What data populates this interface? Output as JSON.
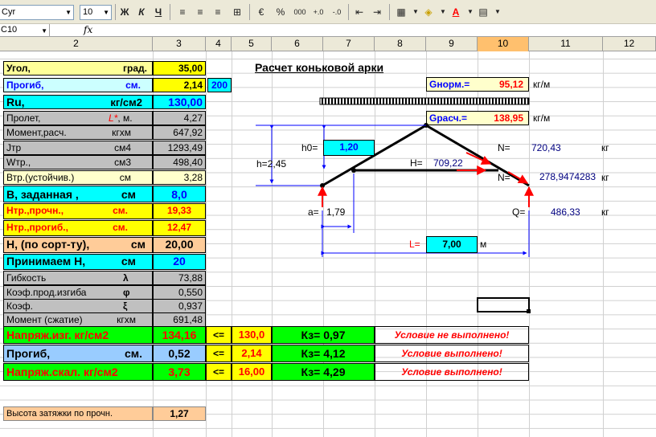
{
  "toolbar": {
    "font_name": "Cyr",
    "font_size": "10",
    "bold": "Ж",
    "italic": "К",
    "underline": "Ч",
    "percent": "%",
    "thousands": "000"
  },
  "formula_bar": {
    "cell_ref": "C10",
    "fx": "fx",
    "formula": ""
  },
  "columns": [
    "2",
    "3",
    "4",
    "5",
    "6",
    "7",
    "8",
    "9",
    "10",
    "11",
    "12"
  ],
  "cells": {
    "angle_label": "Угол,",
    "angle_unit": "град.",
    "angle_val": "35,00",
    "defl_label": "Прогиб,",
    "defl_unit": "см.",
    "defl_val": "2,14",
    "defl_ratio": "200",
    "ru_label": "Ru,",
    "ru_unit": "кг/см2",
    "ru_val": "130,00",
    "span_label": "Пролет,",
    "span_L": "L*",
    "span_unit": ", м.",
    "span_val": "4,27",
    "moment_label": "Момент,расч.",
    "moment_unit": "кгхм",
    "moment_val": "647,92",
    "jtr_label": "Jтр",
    "jtr_unit": "см4",
    "jtr_val": "1293,49",
    "wtr_label": "Wтр.,",
    "wtr_unit": "см3",
    "wtr_val": "498,40",
    "vtr_label": "Втр.(устойчив.)",
    "vtr_unit": "см",
    "vtr_val": "3,28",
    "b_label": "В, заданная ,",
    "b_unit": "см",
    "b_val": "8,0",
    "hp_label": "Нтр.,прочн.,",
    "hp_unit": "см.",
    "hp_val": "19,33",
    "hd_label": "Нтр.,прогиб.,",
    "hd_unit": "см.",
    "hd_val": "12,47",
    "hs_label": "Н, (по сорт-ту),",
    "hs_unit": "см",
    "hs_val": "20,00",
    "ha_label": "Принимаем  Н,",
    "ha_unit": "см",
    "ha_val": "20",
    "flex_label": "Гибкость",
    "flex_sym": "λ",
    "flex_val": "73,88",
    "kbend_label": "Коэф.прод.изгиба",
    "kbend_sym": "φ",
    "kbend_val": "0,550",
    "k_label": "Коэф.",
    "k_sym": "ξ",
    "k_val": "0,937",
    "mc_label": "Момент (сжатие)",
    "mc_unit": "кгхм",
    "mc_val": "691,48",
    "stress_label": "Напряж.изг.   кг/см2",
    "stress_val": "134,16",
    "stress_cmp": "<=",
    "stress_lim": "130,0",
    "stress_kz": "Кз=  0,97",
    "stress_msg": "Условие не выполнено!",
    "def2_label": "Прогиб,",
    "def2_unit": "см.",
    "def2_val": "0,52",
    "def2_cmp": "<=",
    "def2_lim": "2,14",
    "def2_kz": "Кз=  4,12",
    "def2_msg": "Условие выполнено!",
    "shear_label": "Напряж.скал. кг/см2",
    "shear_val": "3,73",
    "shear_cmp": "<=",
    "shear_lim": "16,00",
    "shear_kz": "Кз=  4,29",
    "shear_msg": "Условие выполнено!",
    "tie_label": "Высота затяжки по прочн.",
    "tie_val": "1,27"
  },
  "diagram": {
    "title": "Расчет коньковой арки",
    "gnorm_label": "Gнорм.=",
    "gnorm_val": "95,12",
    "gnorm_unit": "кг/м",
    "gcalc_label": "Gрасч.=",
    "gcalc_val": "138,95",
    "gcalc_unit": "кг/м",
    "h0_label": "h0=",
    "h0_val": "1,20",
    "h_label": "h=",
    "h_val": "2,45",
    "H_label": "H=",
    "H_val": "709,22",
    "N1_label": "N=",
    "N1_val": "720,43",
    "N1_unit": "кг",
    "N2_label": "N=",
    "N2_val": "278,9474283",
    "N2_unit": "кг",
    "a_label": "a=",
    "a_val": "1,79",
    "Q_label": "Q=",
    "Q_val": "486,33",
    "Q_unit": "кг",
    "L_label": "L=",
    "L_val": "7,00",
    "L_unit": "м"
  },
  "colors": {
    "accent_select": "#ffc06e",
    "ok_green": "#00ff00",
    "warn_red": "#ff0000"
  }
}
